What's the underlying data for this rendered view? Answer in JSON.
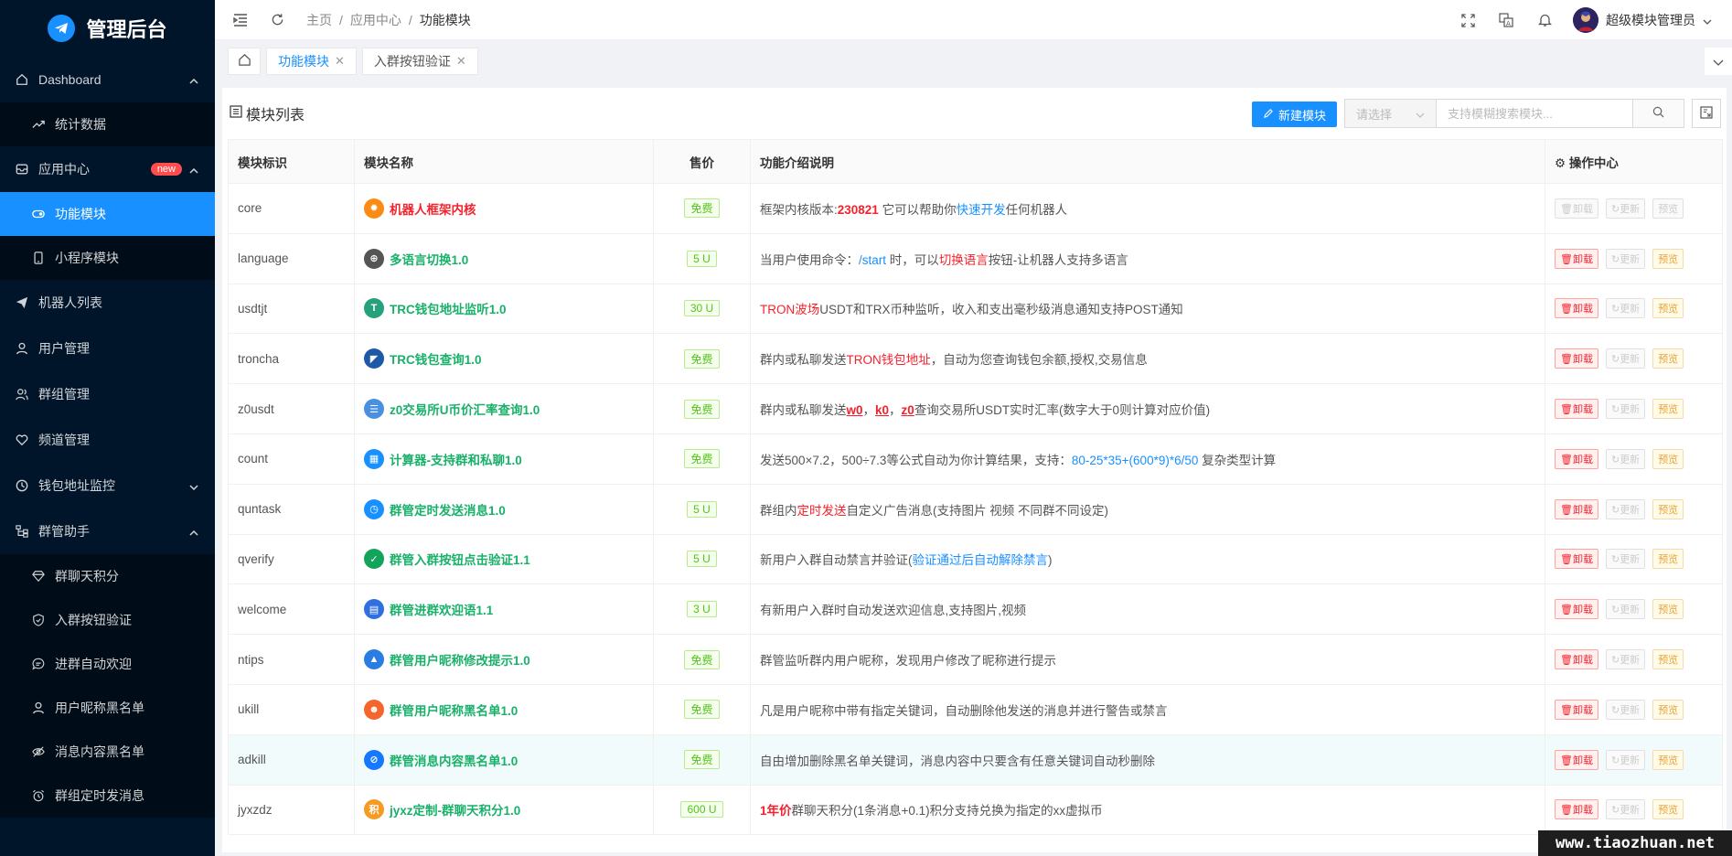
{
  "app": {
    "title": "管理后台",
    "accent": "#1890ff",
    "sidebar_bg": "#001529"
  },
  "sidebar": {
    "items": [
      {
        "label": "Dashboard",
        "icon": "home-icon",
        "arrow": "up"
      },
      {
        "label": "统计数据",
        "icon": "trend-icon",
        "sub": true
      },
      {
        "label": "应用中心",
        "icon": "app-center-icon",
        "badge": "new",
        "arrow": "up"
      },
      {
        "label": "功能模块",
        "icon": "toggle-icon",
        "sub": true,
        "active": true
      },
      {
        "label": "小程序模块",
        "icon": "mobile-icon",
        "sub": true
      },
      {
        "label": "机器人列表",
        "icon": "send-icon"
      },
      {
        "label": "用户管理",
        "icon": "user-icon"
      },
      {
        "label": "群组管理",
        "icon": "group-icon"
      },
      {
        "label": "频道管理",
        "icon": "heart-icon"
      },
      {
        "label": "钱包地址监控",
        "icon": "clock-icon",
        "arrow": "down"
      },
      {
        "label": "群管助手",
        "icon": "tree-icon",
        "arrow": "up"
      },
      {
        "label": "群聊天积分",
        "icon": "diamond-icon",
        "sub": true
      },
      {
        "label": "入群按钮验证",
        "icon": "shield-icon",
        "sub": true
      },
      {
        "label": "进群自动欢迎",
        "icon": "chat-icon",
        "sub": true
      },
      {
        "label": "用户昵称黑名单",
        "icon": "user-icon",
        "sub": true
      },
      {
        "label": "消息内容黑名单",
        "icon": "eye-off-icon",
        "sub": true
      },
      {
        "label": "群组定时发消息",
        "icon": "alarm-icon",
        "sub": true
      }
    ]
  },
  "header": {
    "breadcrumb": [
      "主页",
      "应用中心",
      "功能模块"
    ],
    "user_name": "超级模块管理员"
  },
  "tabs": [
    {
      "label": "功能模块",
      "active": true
    },
    {
      "label": "入群按钮验证",
      "active": false
    }
  ],
  "card": {
    "title": "模块列表",
    "new_button": "新建模块",
    "select_placeholder": "请选择",
    "search_placeholder": "支持模糊搜索模块..."
  },
  "table": {
    "columns": [
      "模块标识",
      "模块名称",
      "售价",
      "功能介绍说明",
      "操作中心"
    ],
    "op_labels": {
      "uninstall": "卸载",
      "update": "更新",
      "preview": "预览"
    },
    "rows": [
      {
        "id": "core",
        "name": "机器人框架内核",
        "name_red": true,
        "icon_color": "#fa8c16",
        "icon_glyph": "✹",
        "price": "免费",
        "desc": [
          {
            "t": "框架内核版本:"
          },
          {
            "t": "230821",
            "c": "red",
            "b": true
          },
          {
            "t": " 它可以帮助你"
          },
          {
            "t": "快速开发",
            "c": "blue"
          },
          {
            "t": "任何机器人"
          }
        ],
        "ops_disabled": true
      },
      {
        "id": "language",
        "name": "多语言切换1.0",
        "icon_color": "#555",
        "icon_glyph": "⊕",
        "price": "5 U",
        "desc": [
          {
            "t": "当用户使用命令："
          },
          {
            "t": "/start",
            "c": "blue"
          },
          {
            "t": " 时，可以"
          },
          {
            "t": "切换语言",
            "c": "red"
          },
          {
            "t": "按钮-让机器人支持多语言"
          }
        ]
      },
      {
        "id": "usdtjt",
        "name": "TRC钱包地址监听1.0",
        "icon_color": "#26a17b",
        "icon_glyph": "T",
        "price": "30 U",
        "desc": [
          {
            "t": "TRON波场",
            "c": "red"
          },
          {
            "t": "USDT和TRX币种监听，收入和支出毫秒级消息通知支持POST通知"
          }
        ]
      },
      {
        "id": "troncha",
        "name": "TRC钱包查询1.0",
        "icon_color": "#1c5aa8",
        "icon_glyph": "◤",
        "price": "免费",
        "desc": [
          {
            "t": "群内或私聊发送"
          },
          {
            "t": "TRON钱包地址",
            "c": "red"
          },
          {
            "t": "，自动为您查询钱包余额,授权,交易信息"
          }
        ]
      },
      {
        "id": "z0usdt",
        "name": "z0交易所U币价汇率查询1.0",
        "icon_color": "#4a90e2",
        "icon_glyph": "☰",
        "price": "免费",
        "desc": [
          {
            "t": "群内或私聊发送"
          },
          {
            "t": "w0",
            "c": "red",
            "b": true,
            "u": true
          },
          {
            "t": "，"
          },
          {
            "t": "k0",
            "c": "red",
            "b": true,
            "u": true
          },
          {
            "t": "，"
          },
          {
            "t": "z0",
            "c": "red",
            "b": true,
            "u": true
          },
          {
            "t": "查询交易所USDT实时汇率(数字大于0则计算对应价值)"
          }
        ]
      },
      {
        "id": "count",
        "name": "计算器-支持群和私聊1.0",
        "icon_color": "#1890ff",
        "icon_glyph": "▦",
        "price": "免费",
        "desc": [
          {
            "t": "发送500×7.2，500÷7.3等公式自动为你计算结果，支持："
          },
          {
            "t": "80-25*35+(600*9)*6/50",
            "c": "blue"
          },
          {
            "t": " 复杂类型计算"
          }
        ]
      },
      {
        "id": "quntask",
        "name": "群管定时发送消息1.0",
        "icon_color": "#1890ff",
        "icon_glyph": "◷",
        "price": "5 U",
        "desc": [
          {
            "t": "群组内"
          },
          {
            "t": "定时发送",
            "c": "red"
          },
          {
            "t": "自定义广告消息(支持图片 视频 不同群不同设定)"
          }
        ]
      },
      {
        "id": "qverify",
        "name": "群管入群按钮点击验证1.1",
        "icon_color": "#13a35b",
        "icon_glyph": "✓",
        "price": "5 U",
        "desc": [
          {
            "t": "新用户入群自动禁言并验证("
          },
          {
            "t": "验证通过后自动解除禁言",
            "c": "blue"
          },
          {
            "t": ")"
          }
        ]
      },
      {
        "id": "welcome",
        "name": "群管进群欢迎语1.1",
        "icon_color": "#2f6fe0",
        "icon_glyph": "▤",
        "price": "3 U",
        "desc": [
          {
            "t": "有新用户入群时自动发送欢迎信息,支持图片,视频"
          }
        ]
      },
      {
        "id": "ntips",
        "name": "群管用户昵称修改提示1.0",
        "icon_color": "#2a7de1",
        "icon_glyph": "▲",
        "price": "免费",
        "desc": [
          {
            "t": "群管监听群内用户昵称，发现用户修改了昵称进行提示"
          }
        ]
      },
      {
        "id": "ukill",
        "name": "群管用户昵称黑名单1.0",
        "icon_color": "#f5662d",
        "icon_glyph": "☻",
        "price": "免费",
        "desc": [
          {
            "t": "凡是用户昵称中带有指定关键词，自动删除他发送的消息并进行警告或禁言"
          }
        ]
      },
      {
        "id": "adkill",
        "name": "群管消息内容黑名单1.0",
        "icon_color": "#1677ff",
        "icon_glyph": "⊘",
        "price": "免费",
        "highlight": true,
        "desc": [
          {
            "t": "自由增加删除黑名单关键词，消息内容中只要含有任意关键词自动秒删除"
          }
        ]
      },
      {
        "id": "jyxzdz",
        "name": "jyxz定制-群聊天积分1.0",
        "icon_color": "#f59a23",
        "icon_glyph": "积",
        "price": "600 U",
        "desc": [
          {
            "t": "1年价",
            "c": "red",
            "b": true
          },
          {
            "t": "群聊天积分(1条消息+0.1)积分支持兑换为指定的xx虚拟币"
          }
        ]
      }
    ]
  },
  "watermark": "www.tiaozhuan.net"
}
